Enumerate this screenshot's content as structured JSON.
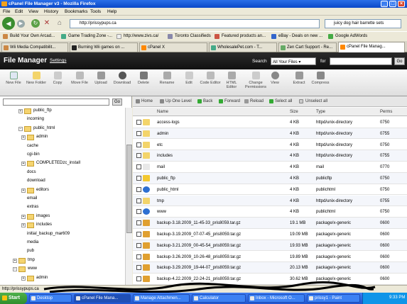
{
  "window": {
    "title": "cPanel File Manager v3 - Mozilla Firefox"
  },
  "menu": [
    "File",
    "Edit",
    "View",
    "History",
    "Bookmarks",
    "Tools",
    "Help"
  ],
  "nav": {
    "url": "http://prissypups.ca",
    "search": "juicy dog hair barrette sets"
  },
  "bookmarks": [
    "Build Your Own Arcad...",
    "Game Trading Zone -...",
    "http://www.zivs.ca/",
    "Toronto Classifieds",
    "Featured products an...",
    "eBay - Deals on new ...",
    "Google AdWords"
  ],
  "tabs": [
    "Wii Media Compatibilit...",
    "Burning Wii games on ...",
    "cPanel X",
    "WholesalePet.com - T...",
    "Zen Cart Support - Re...",
    "cPanel File Manag..."
  ],
  "fm": {
    "title": "File Manager",
    "settings": "Settings",
    "search_label": "Search",
    "search_scope": "All Your Files",
    "for_label": "for",
    "go": "Go"
  },
  "toolbar": [
    "New File",
    "New Folder",
    "Copy",
    "Move File",
    "Upload",
    "Download",
    "Delete",
    "Rename",
    "Edit",
    "Code Editor",
    "HTML Editor",
    "Change Permissions",
    "View",
    "Extract",
    "Compress"
  ],
  "tree": {
    "go": "Go",
    "nodes": [
      {
        "label": "public_ftp",
        "plus": "+",
        "folder": true
      },
      {
        "label": "incoming",
        "plus": "",
        "folder": false
      },
      {
        "label": "public_html",
        "plus": "−",
        "folder": true
      },
      {
        "label": "admin",
        "plus": "+",
        "folder": true
      },
      {
        "label": "cache",
        "plus": "",
        "folder": false
      },
      {
        "label": "cgi-bin",
        "plus": "",
        "folder": false
      },
      {
        "label": "COMPLETEDzc_install",
        "plus": "+",
        "folder": true
      },
      {
        "label": "docs",
        "plus": "",
        "folder": false
      },
      {
        "label": "download",
        "plus": "",
        "folder": false
      },
      {
        "label": "editors",
        "plus": "+",
        "folder": true
      },
      {
        "label": "email",
        "plus": "",
        "folder": false
      },
      {
        "label": "extras",
        "plus": "",
        "folder": false
      },
      {
        "label": "images",
        "plus": "+",
        "folder": true
      },
      {
        "label": "includes",
        "plus": "+",
        "folder": true
      },
      {
        "label": "initial_backup_mar609",
        "plus": "",
        "folder": false
      },
      {
        "label": "media",
        "plus": "",
        "folder": false
      },
      {
        "label": "pub",
        "plus": "",
        "folder": false
      },
      {
        "label": "tmp",
        "plus": "+",
        "folder": true
      },
      {
        "label": "www",
        "plus": "−",
        "folder": true
      },
      {
        "label": "admin",
        "plus": "+",
        "folder": true
      }
    ]
  },
  "navrow": [
    "Home",
    "Up One Level",
    "Back",
    "Forward",
    "Reload",
    "Select all",
    "Unselect all"
  ],
  "columns": [
    "Name",
    "Size",
    "Type",
    "Perms"
  ],
  "files": [
    {
      "name": "access-logs",
      "size": "4 KB",
      "type": "httpd/unix-directory",
      "perms": "0750",
      "icon": "folder"
    },
    {
      "name": "admin",
      "size": "4 KB",
      "type": "httpd/unix-directory",
      "perms": "0755",
      "icon": "folder"
    },
    {
      "name": "etc",
      "size": "4 KB",
      "type": "httpd/unix-directory",
      "perms": "0750",
      "icon": "folder"
    },
    {
      "name": "includes",
      "size": "4 KB",
      "type": "httpd/unix-directory",
      "perms": "0755",
      "icon": "folder"
    },
    {
      "name": "mail",
      "size": "4 KB",
      "type": "mail",
      "perms": "0770",
      "icon": "mail"
    },
    {
      "name": "public_ftp",
      "size": "4 KB",
      "type": "publicftp",
      "perms": "0750",
      "icon": "ftp"
    },
    {
      "name": "public_html",
      "size": "4 KB",
      "type": "publichtml",
      "perms": "0750",
      "icon": "globe"
    },
    {
      "name": "tmp",
      "size": "4 KB",
      "type": "httpd/unix-directory",
      "perms": "0755",
      "icon": "folder"
    },
    {
      "name": "www",
      "size": "4 KB",
      "type": "publichtml",
      "perms": "0750",
      "icon": "globe"
    },
    {
      "name": "backup-3.18.2009_11-45-33_pris8059.tar.gz",
      "size": "19.1 MB",
      "type": "package/x-generic",
      "perms": "0600",
      "icon": "package"
    },
    {
      "name": "backup-3.19.2009_07-07-45_pris8059.tar.gz",
      "size": "19.09 MB",
      "type": "package/x-generic",
      "perms": "0600",
      "icon": "package"
    },
    {
      "name": "backup-3.21.2009_00-45-54_pris8059.tar.gz",
      "size": "19.93 MB",
      "type": "package/x-generic",
      "perms": "0600",
      "icon": "package"
    },
    {
      "name": "backup-3.26.2009_10-26-48_pris8059.tar.gz",
      "size": "19.89 MB",
      "type": "package/x-generic",
      "perms": "0600",
      "icon": "package"
    },
    {
      "name": "backup-3.29.2009_19-44-07_pris8059.tar.gz",
      "size": "20.13 MB",
      "type": "package/x-generic",
      "perms": "0600",
      "icon": "package"
    },
    {
      "name": "backup-4.22.2009_22-24-21_pris8059.tar.gz",
      "size": "30.62 MB",
      "type": "package/x-generic",
      "perms": "0600",
      "icon": "package"
    }
  ],
  "status": "http://prissypups.ca",
  "taskbar": {
    "start": "Start",
    "tasks": [
      "Desktop",
      "cPanel File Mana...",
      "Manage Attachmen...",
      "Calculator",
      "Inbox - Microsoft O...",
      "prissy1 - Paint"
    ],
    "clock": "9:33 PM"
  }
}
